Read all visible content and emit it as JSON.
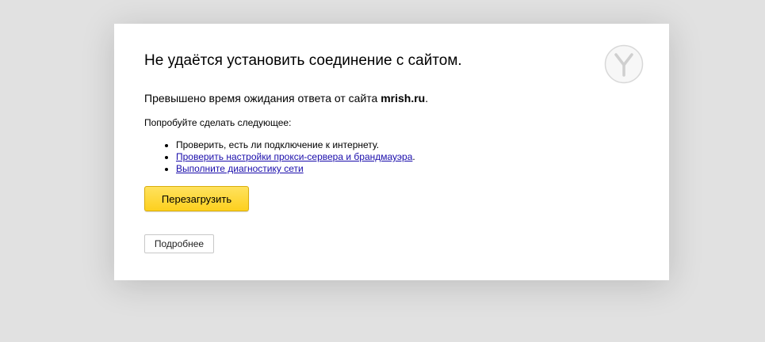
{
  "error": {
    "title": "Не удаётся установить соединение с сайтом.",
    "summary_prefix": "Превышено время ожидания ответа от сайта ",
    "site": "mrish.ru",
    "summary_suffix": ".",
    "hint": "Попробуйте сделать следующее:",
    "suggestions": [
      {
        "text": "Проверить, есть ли подключение к интернету.",
        "link": "",
        "after": ""
      },
      {
        "text": "",
        "link": "Проверить настройки прокси-сервера и брандмауэра",
        "after": "."
      },
      {
        "text": "",
        "link": "Выполните диагностику сети",
        "after": ""
      }
    ]
  },
  "buttons": {
    "reload_label": "Перезагрузить",
    "details_label": "Подробнее"
  },
  "icons": {
    "logo": "yandex-browser-logo-icon"
  },
  "colors": {
    "page_background": "#e1e1e1",
    "card_background": "#ffffff",
    "reload_button": "#fdd01e",
    "link": "#1a0dab"
  }
}
